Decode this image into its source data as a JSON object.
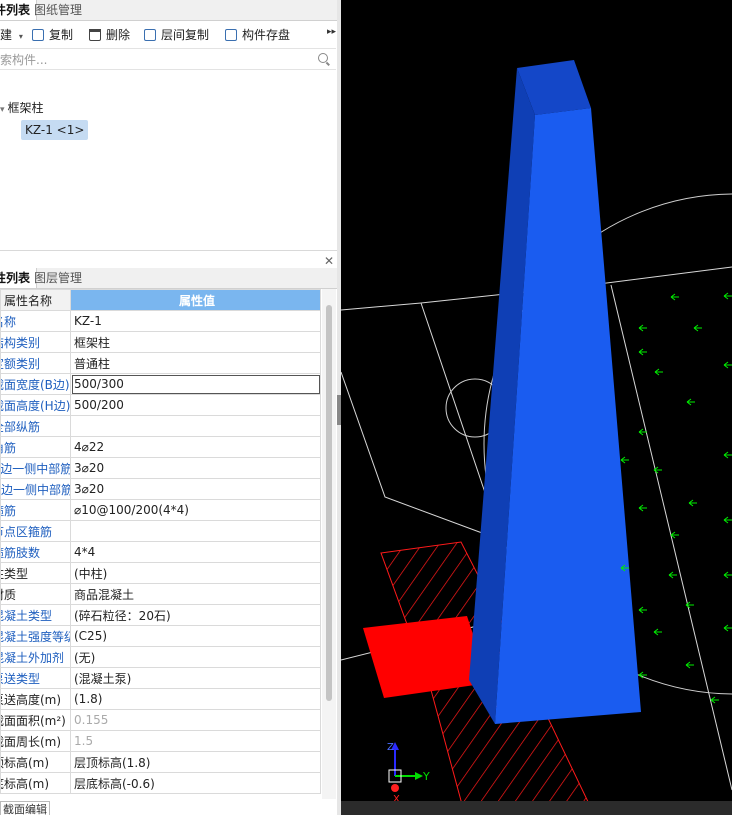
{
  "component_panel": {
    "tabs": [
      "构件列表",
      "图纸管理"
    ],
    "toolbar": {
      "new": "新建",
      "copy": "复制",
      "delete": "删除",
      "floor_copy": "层间复制",
      "save": "构件存盘"
    },
    "search_placeholder": "搜索构件...",
    "tree": {
      "parent": "框架柱",
      "child": "KZ-1 <1>"
    }
  },
  "property_panel": {
    "tabs": [
      "属性列表",
      "图层管理"
    ],
    "header": {
      "name": "属性名称",
      "value": "属性值"
    },
    "rows": [
      {
        "name": "名称",
        "value": "KZ-1"
      },
      {
        "name": "结构类别",
        "value": "框架柱"
      },
      {
        "name": "定额类别",
        "value": "普通柱"
      },
      {
        "name": "截面宽度(B边)(mm)",
        "value": "500/300"
      },
      {
        "name": "截面高度(H边)(mm)",
        "value": "500/200"
      },
      {
        "name": "全部纵筋",
        "value": ""
      },
      {
        "name": "角筋",
        "value": "4⌀22"
      },
      {
        "name": "B边一侧中部筋",
        "value": "3⌀20"
      },
      {
        "name": "H边一侧中部筋",
        "value": "3⌀20"
      },
      {
        "name": "箍筋",
        "value": "⌀10@100/200(4*4)"
      },
      {
        "name": "节点区箍筋",
        "value": ""
      },
      {
        "name": "箍筋肢数",
        "value": "4*4"
      },
      {
        "name": "柱类型",
        "value": "(中柱)"
      },
      {
        "name": "材质",
        "value": "商品混凝土"
      },
      {
        "name": "混凝土类型",
        "value": "(碎石粒径：20石)"
      },
      {
        "name": "混凝土强度等级",
        "value": "(C25)"
      },
      {
        "name": "混凝土外加剂",
        "value": "(无)"
      },
      {
        "name": "泵送类型",
        "value": "(混凝土泵)"
      },
      {
        "name": "泵送高度(m)",
        "value": "(1.8)"
      },
      {
        "name": "截面面积(m²)",
        "value": "0.155"
      },
      {
        "name": "截面周长(m)",
        "value": "1.5"
      },
      {
        "name": "顶标高(m)",
        "value": "层顶标高(1.8)"
      },
      {
        "name": "底标高(m)",
        "value": "层底标高(-0.6)"
      }
    ],
    "bottom_tab": "截面编辑"
  },
  "viewport": {
    "axes": {
      "x": "X",
      "y": "Y",
      "z": "Z"
    },
    "colors": {
      "background": "#000000",
      "column": "#1a5cf0",
      "column_top": "#1447c8",
      "slab": "#ff0000",
      "arrows": "#00ee00",
      "lines": "#d8d8d8"
    }
  }
}
